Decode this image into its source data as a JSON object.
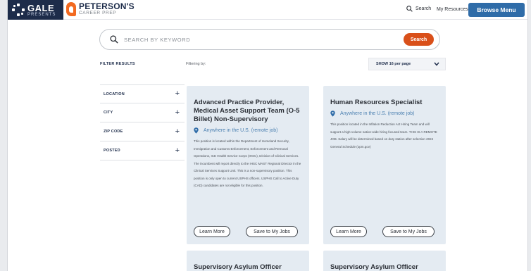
{
  "header": {
    "gale": {
      "name": "GALE",
      "sub": "PRESENTS"
    },
    "peterson": {
      "name": "PETERSON'S",
      "sub": "CAREER PREP"
    },
    "search_label": "Search",
    "resources_label": "My Resources",
    "browse_label": "Browse Menu"
  },
  "search": {
    "placeholder": "SEARCH BY KEYWORD",
    "button_label": "Search"
  },
  "filters": {
    "title": "FILTER RESULTS",
    "filtering_by": "Filtering by:",
    "per_page": "SHOW 16 per page",
    "items": [
      {
        "label": "LOCATION"
      },
      {
        "label": "CITY"
      },
      {
        "label": "ZIP CODE"
      },
      {
        "label": "POSTED"
      }
    ]
  },
  "jobs": [
    {
      "title": "Advanced Practice Provider, Medical Asset Support Team (O-5 Billet) Non-Supervisory",
      "location": "Anywhere in the U.S. (remote job)",
      "description": "This position is located within the Department of Homeland Security, Immigration and Customs Enforcement, Enforcement and Removal Operations, ICE Health Service Corps (IHSC), Division of Clinical Services. The incumbent will report directly to the IHSC MAST Regional Director in the Clinical Services Support Unit. This is a non-supervisory position. This position is only open to current USPHS officers. USPHS Call to Active Duty (CAD) candidates are not eligible for this position.",
      "learn_label": "Learn More",
      "save_label": "Save to My Jobs"
    },
    {
      "title": "Human Resources Specialist",
      "location": "Anywhere in the U.S. (remote job)",
      "description": "This position located in the Inflation Reduction Act Hiring Team and will support a high-volume nation-wide hiring focused team. THIS IS A REMOTE JOB. Salary will be determined based on duty station after selection 2024 General Schedule (opm.gov)",
      "learn_label": "Learn More",
      "save_label": "Save to My Jobs"
    },
    {
      "title": "Supervisory Asylum Officer"
    },
    {
      "title": "Supervisory Asylum Officer"
    }
  ],
  "colors": {
    "brand_navy": "#1d2c4a",
    "browse_blue": "#2f6ca8",
    "search_orange": "#d9501a",
    "peterson_orange": "#f26a21",
    "location_blue": "#4a7fb0",
    "card_bg": "#e4ebf2"
  },
  "icons": {
    "search": "search-icon",
    "location": "location-pin-icon",
    "chevron": "chevron-down-icon",
    "expand": "plus-icon"
  }
}
